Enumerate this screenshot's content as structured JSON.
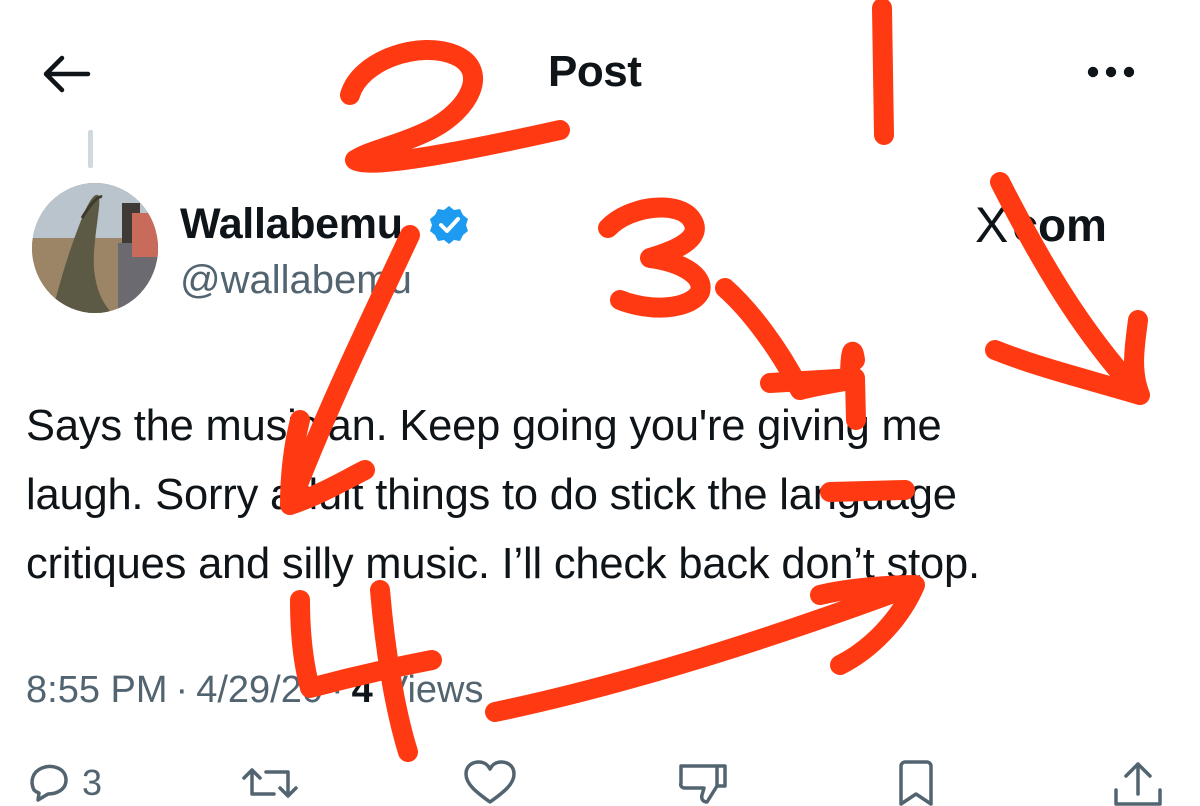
{
  "header": {
    "title": "Post",
    "back_icon": "arrow-left-icon",
    "more_icon": "more-horizontal-icon"
  },
  "post": {
    "author": {
      "display_name": "Wallabemu",
      "handle": "@wallabemu",
      "verified": true,
      "verified_color": "#1d9bf0"
    },
    "source": {
      "prefix": "X",
      "suffix": "com"
    },
    "text_lines": [
      "Says the musician. Keep going you're giving me",
      "laugh. Sorry adult things to do stick the language",
      "critiques and silly music. I’ll check back don’t stop."
    ],
    "meta": {
      "time": "8:55 PM",
      "separator": "·",
      "date": "4/29/20",
      "views_count": "4",
      "views_label": "Views"
    },
    "actions": {
      "reply_count": "3",
      "reply_icon": "reply-icon",
      "repost_icon": "repost-icon",
      "like_icon": "heart-icon",
      "dislike_icon": "thumbs-down-icon",
      "bookmark_icon": "bookmark-icon",
      "share_icon": "share-icon"
    }
  },
  "annotations": {
    "color": "#ff3a12",
    "numbers": [
      "1",
      "2",
      "3",
      "4"
    ]
  }
}
